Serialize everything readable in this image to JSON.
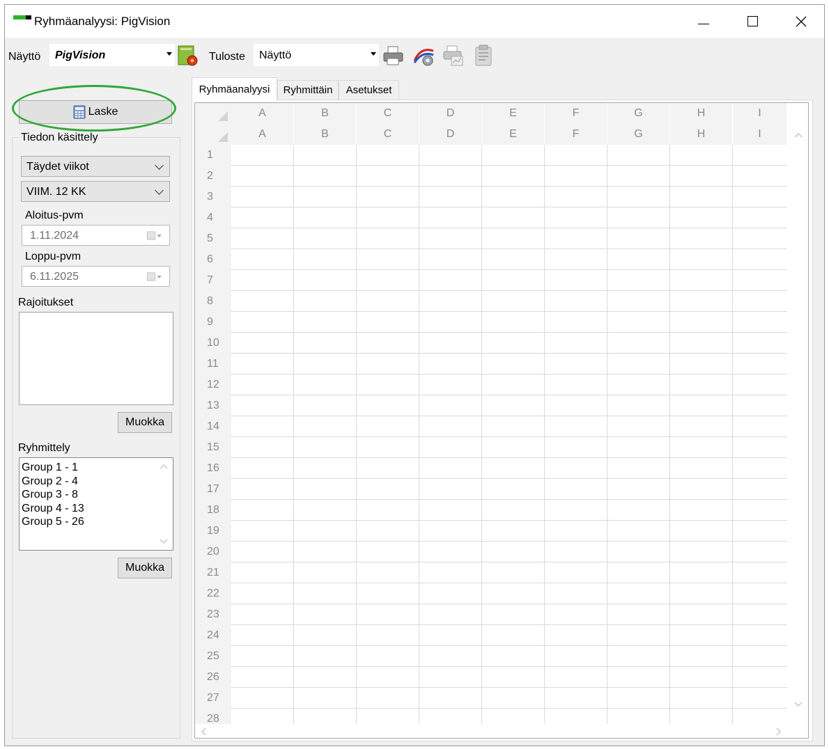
{
  "window": {
    "title": "Ryhmäanalyysi: PigVision"
  },
  "toolbar": {
    "display_label": "Näyttö",
    "display_value": "PigVision",
    "print_label": "Tuloste",
    "print_value": "Näyttö"
  },
  "left": {
    "calc_button": "Laske",
    "data_group_title": "Tiedon käsittely",
    "weeks_select": "Täydet viikot",
    "period_select": "VIIM. 12 KK",
    "start_label": "Aloitus-pvm",
    "start_value": "1.11.2024",
    "end_label": "Loppu-pvm",
    "end_value": "6.11.2025",
    "restrictions_label": "Rajoitukset",
    "edit_button": "Muokka",
    "grouping_label": "Ryhmittely",
    "groups": [
      "Group 1 - 1",
      "Group 2 - 4",
      "Group 3 - 8",
      "Group 4 - 13",
      "Group 5 - 26"
    ],
    "edit_button_2": "Muokka"
  },
  "tabs": [
    "Ryhmäanalyysi",
    "Ryhmittäin",
    "Asetukset"
  ],
  "sheet": {
    "columns": [
      "A",
      "B",
      "C",
      "D",
      "E",
      "F",
      "G",
      "H",
      "I"
    ],
    "rows": [
      "1",
      "2",
      "3",
      "4",
      "5",
      "6",
      "7",
      "8",
      "9",
      "10",
      "11",
      "12",
      "13",
      "14",
      "15",
      "16",
      "17",
      "18",
      "19",
      "20",
      "21",
      "22",
      "23",
      "24",
      "25",
      "26",
      "27",
      "28"
    ]
  },
  "colors": {
    "highlight_oval": "#30a83a",
    "brand_green": "#2bb52b"
  }
}
